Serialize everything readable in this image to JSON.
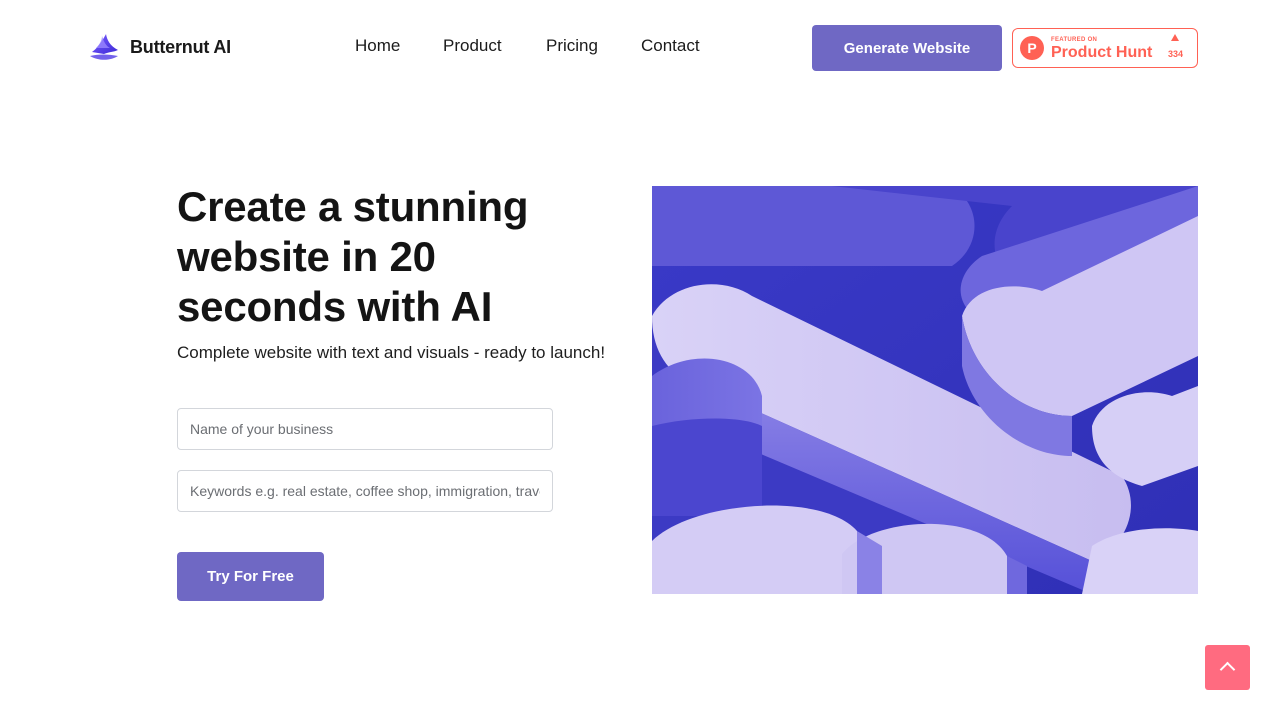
{
  "brand": {
    "name": "Butternut AI",
    "accent": "#6f68c4",
    "logo_icon": "butternut-wing-logo"
  },
  "nav": {
    "items": [
      {
        "label": "Home"
      },
      {
        "label": "Product"
      },
      {
        "label": "Pricing"
      },
      {
        "label": "Contact"
      }
    ]
  },
  "header": {
    "generate_label": "Generate Website",
    "product_hunt": {
      "featured": "FEATURED ON",
      "name": "Product Hunt",
      "votes": "334",
      "color": "#ff6154"
    }
  },
  "hero": {
    "title": "Create a stunning website in 20 seconds with AI",
    "subtitle": "Complete website with text and visuals - ready to launch!",
    "business_placeholder": "Name of your business",
    "keywords_placeholder": "Keywords e.g. real estate, coffee shop, immigration, travel",
    "cta_label": "Try For Free"
  },
  "scroll_top": {
    "icon": "chevron-up-icon",
    "color": "#ff6b80"
  }
}
